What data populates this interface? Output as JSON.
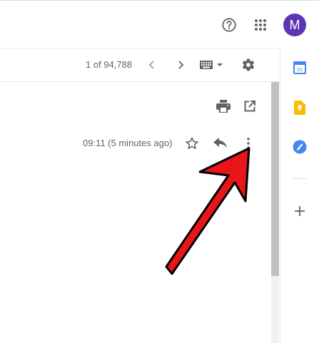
{
  "header": {
    "help_icon": "help-circle-icon",
    "apps_icon": "apps-grid-icon",
    "avatar_letter": "M",
    "avatar_color": "#5e35b1"
  },
  "toolbar": {
    "pager_text": "1 of 94,788",
    "prev_icon": "chevron-left-icon",
    "next_icon": "chevron-right-icon",
    "keyboard_icon": "keyboard-icon",
    "settings_icon": "gear-icon"
  },
  "side_panel": {
    "calendar_label": "31",
    "calendar_color": "#4285f4",
    "keep_color": "#fbbc04",
    "tasks_color": "#4285f4",
    "add_icon": "plus-icon"
  },
  "message": {
    "timestamp": "09:11 (5 minutes ago)",
    "print_icon": "print-icon",
    "popout_icon": "open-in-new-window-icon",
    "star_icon": "star-icon",
    "reply_icon": "reply-icon",
    "more_icon": "more-vertical-icon"
  },
  "annotation": {
    "arrow_color": "#e8161b"
  }
}
